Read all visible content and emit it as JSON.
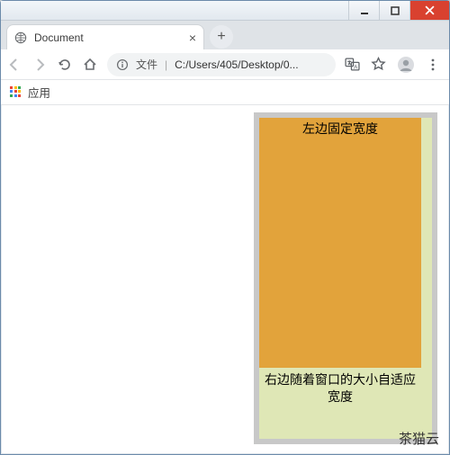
{
  "window": {
    "min": "—",
    "max": "❐",
    "close": "✕"
  },
  "tab": {
    "title": "Document",
    "close": "×"
  },
  "newtab": "+",
  "toolbar": {
    "file_label": "文件",
    "url": "C:/Users/405/Desktop/0..."
  },
  "bookmarks": {
    "apps_label": "应用"
  },
  "content": {
    "left_fixed_label": "左边固定宽度",
    "right_adaptive_label": "右边随着窗口的大小自适应宽度"
  },
  "watermark": "茶猫云"
}
